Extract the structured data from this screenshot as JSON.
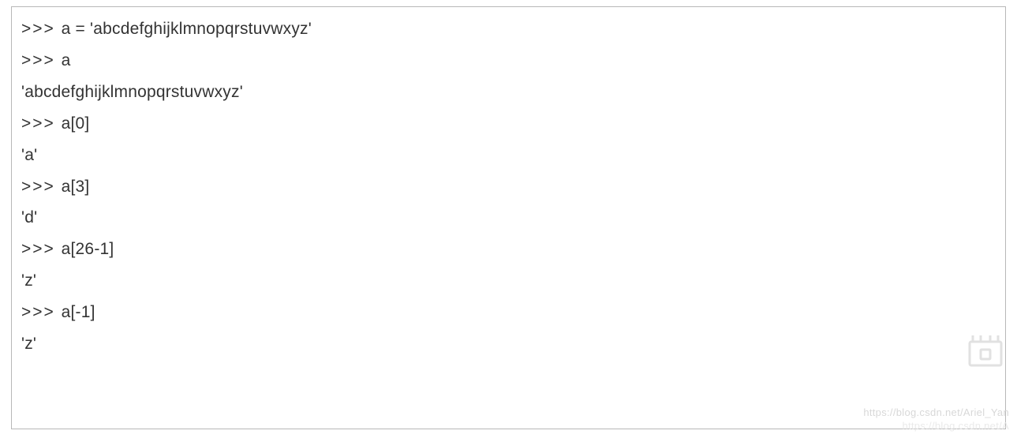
{
  "code": {
    "lines": [
      {
        "prompt": ">>> ",
        "text": "a = 'abcdefghijklmnopqrstuvwxyz'"
      },
      {
        "prompt": ">>> ",
        "text": "a"
      },
      {
        "prompt": "",
        "text": "'abcdefghijklmnopqrstuvwxyz'"
      },
      {
        "prompt": ">>> ",
        "text": "a[0]"
      },
      {
        "prompt": "",
        "text": "'a'"
      },
      {
        "prompt": ">>> ",
        "text": "a[3]"
      },
      {
        "prompt": "",
        "text": "'d'"
      },
      {
        "prompt": ">>> ",
        "text": "a[26-1]"
      },
      {
        "prompt": "",
        "text": "'z'"
      },
      {
        "prompt": ">>> ",
        "text": "a[-1]"
      },
      {
        "prompt": "",
        "text": "'z'"
      }
    ]
  },
  "watermark": {
    "line1": "https://blog.csdn.net/Ariel_Yan",
    "line2": "https://blog.csdn.net/A"
  }
}
